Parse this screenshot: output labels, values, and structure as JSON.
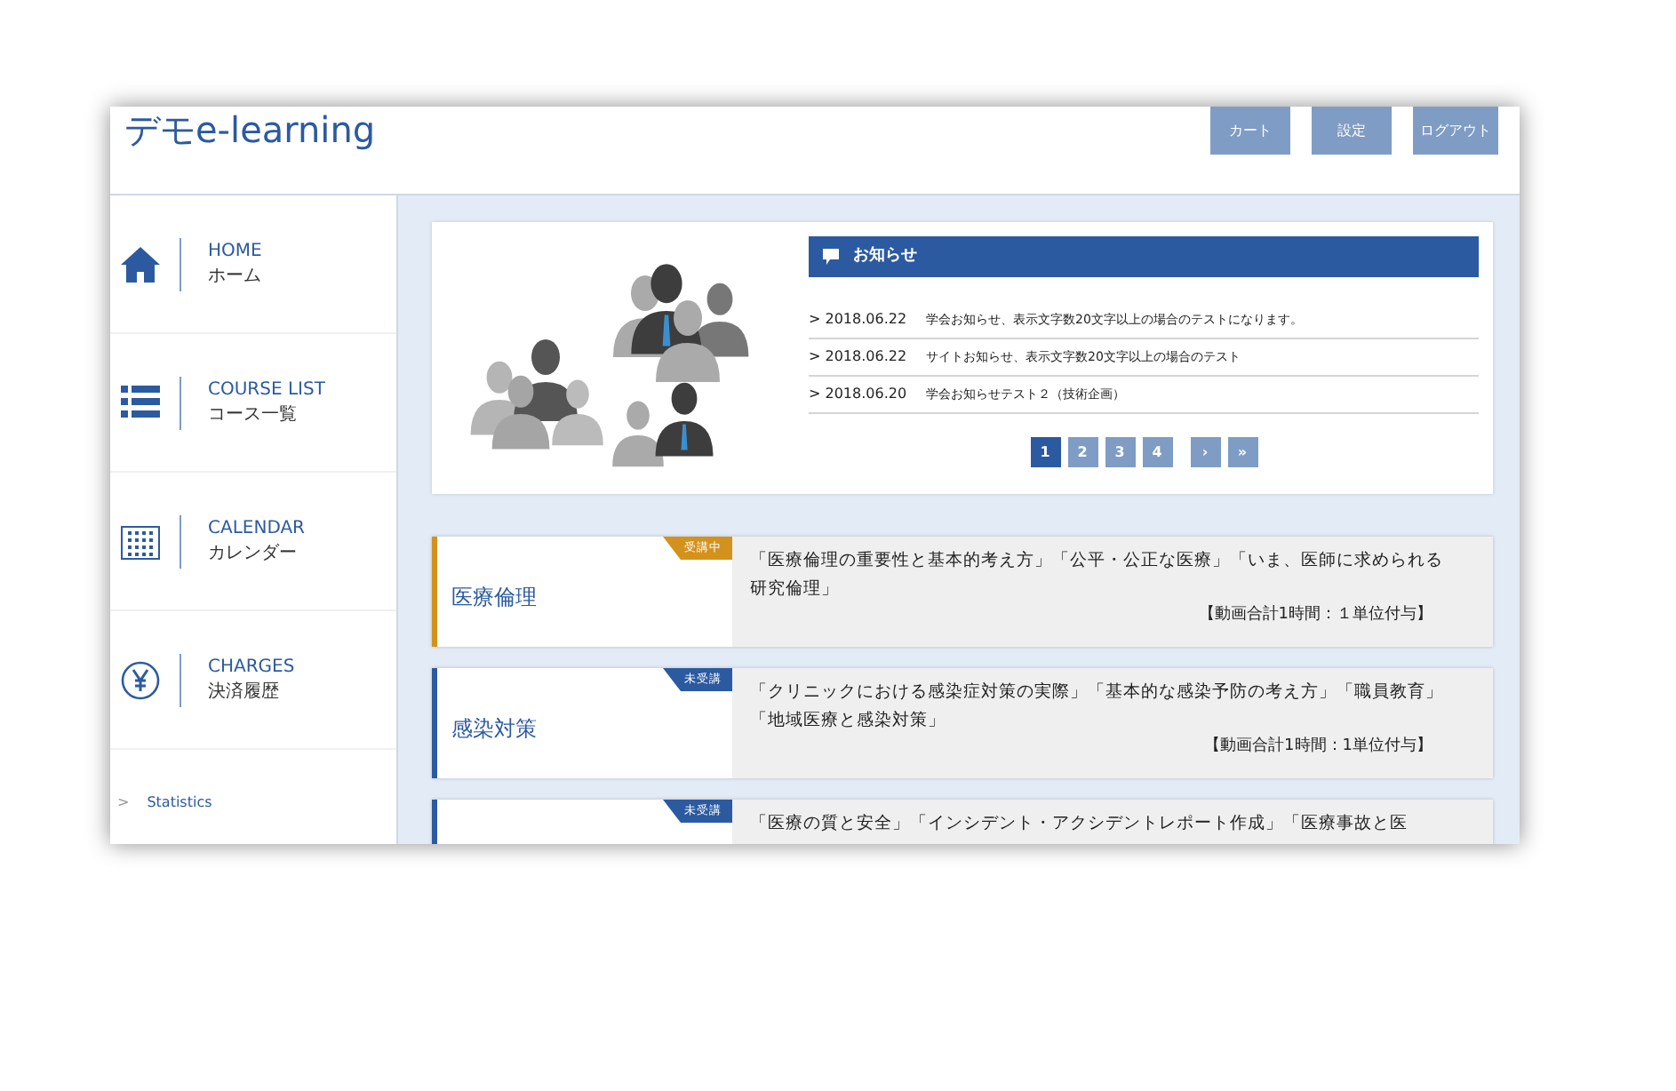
{
  "header": {
    "logo": "デモe-learning",
    "buttons": [
      "カート",
      "設定",
      "ログアウト"
    ]
  },
  "sidebar": {
    "items": [
      {
        "kind": "home",
        "label": "HOME",
        "sublabel": "ホーム"
      },
      {
        "kind": "list",
        "label": "COURSE LIST",
        "sublabel": "コース一覧"
      },
      {
        "kind": "calendar",
        "label": "CALENDAR",
        "sublabel": "カレンダー"
      },
      {
        "kind": "yen",
        "label": "CHARGES",
        "sublabel": "決済履歴"
      }
    ],
    "links": [
      {
        "arrow": ">",
        "label": "Statistics"
      }
    ]
  },
  "notices": {
    "title": "お知らせ",
    "items": [
      {
        "date": "> 2018.06.22",
        "text": "学会お知らせ、表示文字数20文字以上の場合のテストになります。"
      },
      {
        "date": "> 2018.06.22",
        "text": "サイトお知らせ、表示文字数20文字以上の場合のテスト"
      },
      {
        "date": "> 2018.06.20",
        "text": "学会お知らせテスト２（技術企画）"
      }
    ],
    "pagination": [
      {
        "label": "1",
        "selected": true
      },
      {
        "label": "2",
        "selected": false
      },
      {
        "label": "3",
        "selected": false
      },
      {
        "label": "4",
        "selected": false
      },
      {
        "label": "›",
        "selected": false
      },
      {
        "label": "»",
        "selected": false
      }
    ]
  },
  "courses": [
    {
      "title": "医療倫理",
      "status": "受講中",
      "color": "#d4921c",
      "description": "「医療倫理の重要性と基本的考え方」「公平・公正な医療」「いま、医師に求められる研究倫理」",
      "credit": "【動画合計1時間：１単位付与】"
    },
    {
      "title": "感染対策",
      "status": "未受講",
      "color": "#2c5aa0",
      "description": "「クリニックにおける感染症対策の実際」「基本的な感染予防の考え方」「職員教育」「地域医療と感染対策」",
      "credit": "【動画合計1時間：1単位付与】"
    },
    {
      "status": "未受講",
      "color": "#2c5aa0",
      "description": "「医療の質と安全」「インシデント・アクシデントレポート作成」「医療事故と医"
    }
  ]
}
